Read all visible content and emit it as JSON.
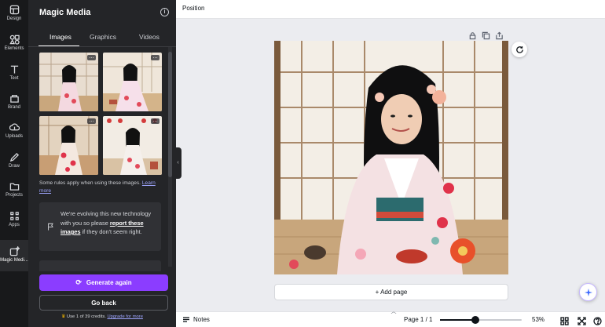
{
  "rail": {
    "items": [
      {
        "label": "Design",
        "icon": "design-icon"
      },
      {
        "label": "Elements",
        "icon": "elements-icon"
      },
      {
        "label": "Text",
        "icon": "text-icon"
      },
      {
        "label": "Brand",
        "icon": "brand-icon"
      },
      {
        "label": "Uploads",
        "icon": "uploads-icon"
      },
      {
        "label": "Draw",
        "icon": "draw-icon"
      },
      {
        "label": "Projects",
        "icon": "projects-icon"
      },
      {
        "label": "Apps",
        "icon": "apps-icon"
      },
      {
        "label": "Magic Medi...",
        "icon": "magic-media-icon"
      }
    ]
  },
  "panel": {
    "title": "Magic Media",
    "tabs": [
      {
        "label": "Images",
        "active": true
      },
      {
        "label": "Graphics",
        "active": false
      },
      {
        "label": "Videos",
        "active": false
      }
    ],
    "rules_text": "Some rules apply when using these images.",
    "rules_link": "Learn more",
    "notice_pre": "We're evolving this new technology with you so please ",
    "notice_link": "report these images",
    "notice_post": " if they don't seem right.",
    "generate_label": "Generate again",
    "back_label": "Go back",
    "credits_text": "Use 1 of 39 credits.",
    "credits_link": "Upgrade for more"
  },
  "topbar": {
    "position_label": "Position"
  },
  "canvas": {
    "add_page_label": "+ Add page"
  },
  "bottombar": {
    "notes_label": "Notes",
    "page_counter": "Page 1 / 1",
    "zoom_percent": 53,
    "zoom_label": "53%",
    "zoom_slider_fraction": 0.43
  },
  "colors": {
    "accent": "#8b3dff",
    "rail_bg": "#18191b",
    "panel_bg": "#242528",
    "canvas_bg": "#ebecf0"
  }
}
